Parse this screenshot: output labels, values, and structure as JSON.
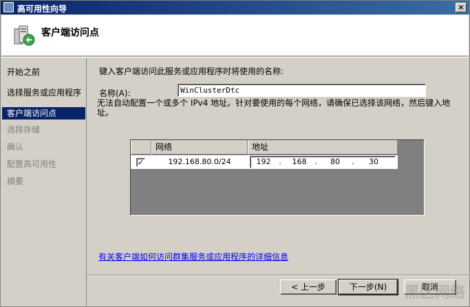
{
  "window": {
    "title": "高可用性向导",
    "close_label": "×"
  },
  "header": {
    "title": "客户端访问点"
  },
  "sidebar": {
    "items": [
      {
        "label": "开始之前",
        "state": "done"
      },
      {
        "label": "选择服务或应用程序",
        "state": "done"
      },
      {
        "label": "客户端访问点",
        "state": "active"
      },
      {
        "label": "选择存储",
        "state": "disabled"
      },
      {
        "label": "确认",
        "state": "disabled"
      },
      {
        "label": "配置高可用性",
        "state": "disabled"
      },
      {
        "label": "摘要",
        "state": "disabled"
      }
    ]
  },
  "main": {
    "intro": "键入客户端访问此服务或应用程序时将使用的名称:",
    "name_label": "名称(A):",
    "name_value": "WinClusterDtc",
    "note": "无法自动配置一个或多个 IPv4 地址。针对要使用的每个网络，请确保已选择该网络，然后键入地址。",
    "grid": {
      "col_network": "网络",
      "col_address": "地址",
      "rows": [
        {
          "checked": "✓",
          "network": "192.168.80.0/24",
          "ip": [
            "192",
            "168",
            "80",
            "30"
          ]
        }
      ]
    },
    "help_link": "有关客户端如何访问群集服务或应用程序的详细信息"
  },
  "footer": {
    "back_label": "< 上一步",
    "next_label": "下一步(N)",
    "cancel_label": "取消"
  },
  "watermark": {
    "text": "黑区网络"
  },
  "colors": {
    "titlebar": "#0a246a",
    "active_nav": "#0a246a",
    "link": "#0000ee",
    "grid_bg": "#808080"
  }
}
